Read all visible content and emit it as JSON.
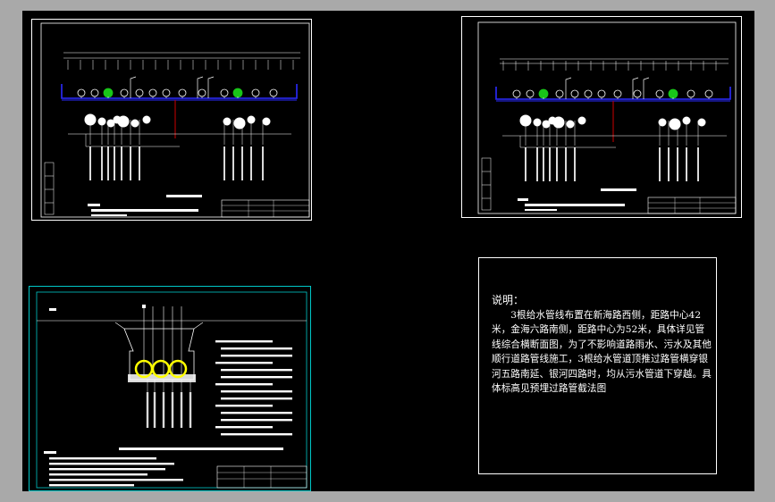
{
  "colors": {
    "background": "#a9a9a9",
    "canvas": "#000000",
    "frame": "#ffffff",
    "road": "#2a2aff",
    "pipe_red": "#cc0000",
    "tree_green": "#19c619",
    "pipe_yellow": "#ffff00",
    "selection_cyan": "#00c8c8"
  },
  "notes": {
    "title": "说明：",
    "body": "3根给水管线布置在新海路西侧，距路中心42米，金海六路南侧，距路中心为52米，具体详见管线综合横断面图，为了不影响道路雨水、污水及其他顺行道路管线施工，3根给水管道顶推过路管横穿银河五路南延、银河四路时，均从污水管道下穿越。具体标高见预埋过路管截法图"
  },
  "sheets": [
    {
      "id": "sheet-top-left",
      "type": "cross-section",
      "selected": false
    },
    {
      "id": "sheet-top-right",
      "type": "cross-section",
      "selected": false
    },
    {
      "id": "sheet-bottom-left",
      "type": "pipe-detail",
      "selected": true
    }
  ]
}
